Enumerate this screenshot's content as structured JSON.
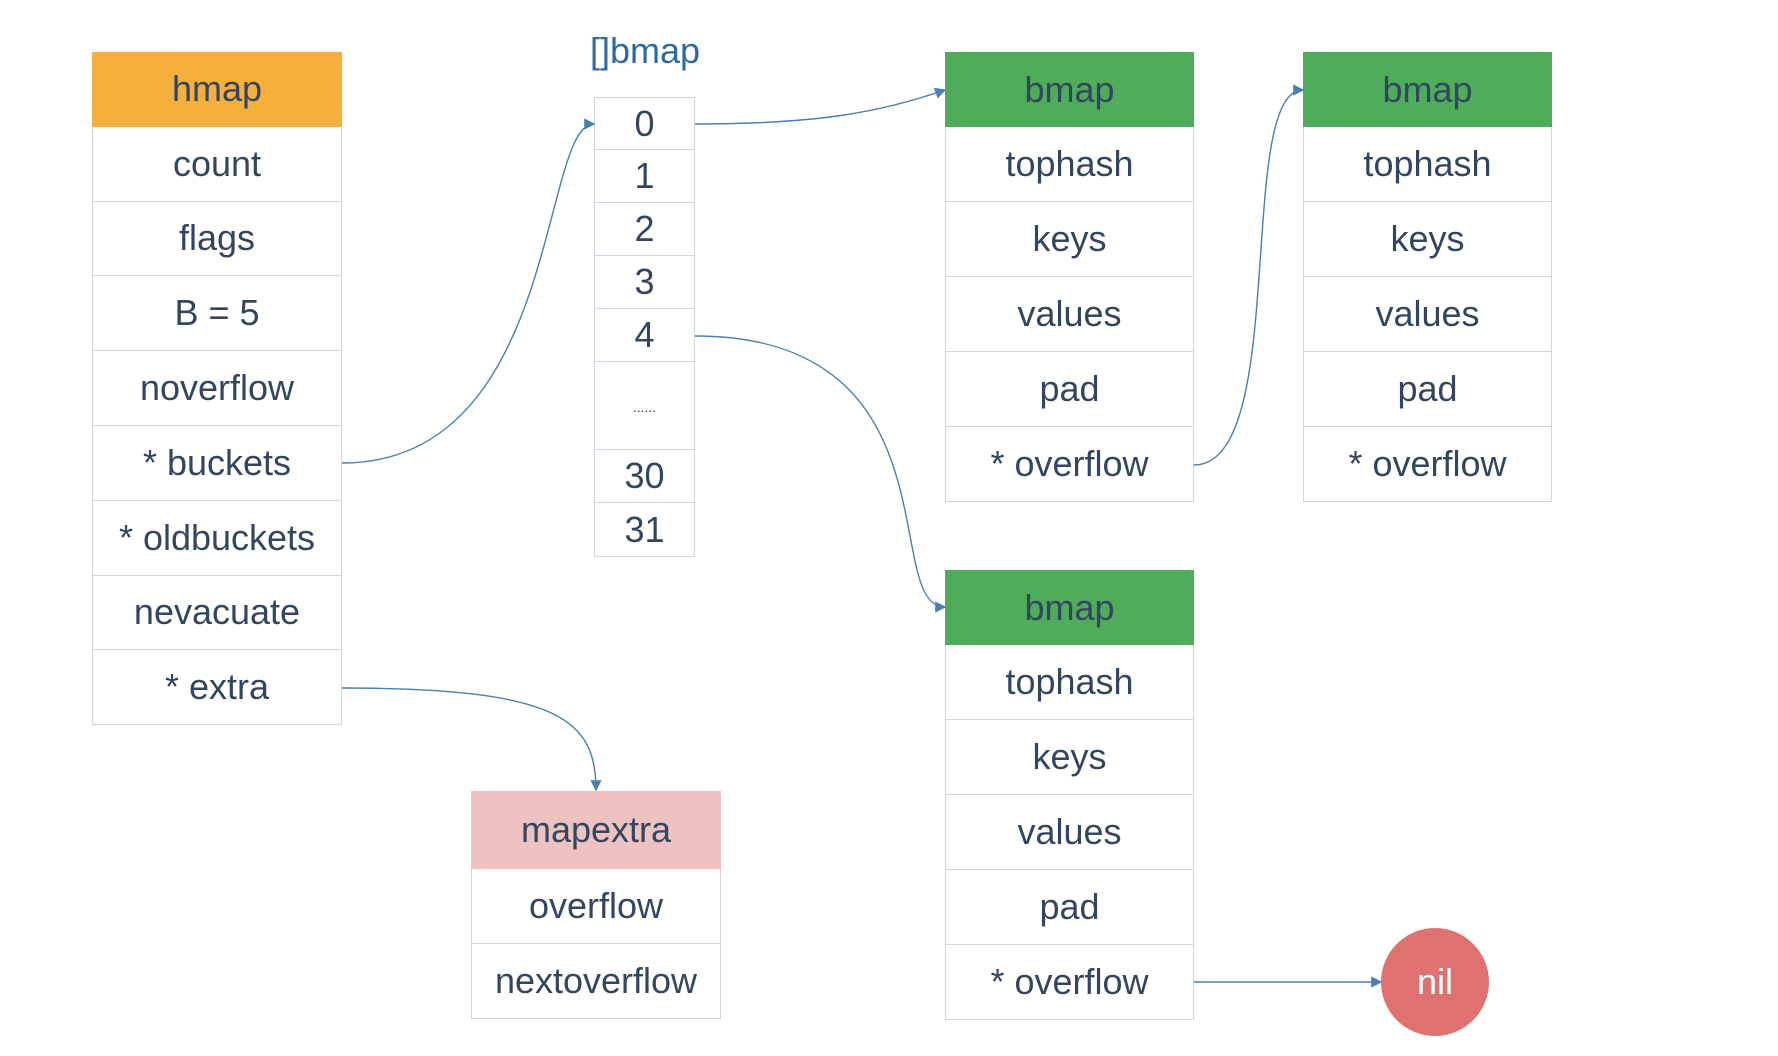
{
  "colors": {
    "hmap": "#F4AF3D",
    "bmap": "#4FAC5B",
    "mapextra": "#EEC2C1",
    "nil": "#DF7271",
    "arrow": "#4A7FB0"
  },
  "hmap": {
    "title": "hmap",
    "fields": [
      "count",
      "flags",
      "B = 5",
      "noverflow",
      "* buckets",
      "* oldbuckets",
      "nevacuate",
      "* extra"
    ]
  },
  "bucket_array": {
    "title": "[]bmap",
    "cells": [
      "0",
      "1",
      "2",
      "3",
      "4",
      "......",
      "30",
      "31"
    ]
  },
  "bmaps": [
    {
      "title": "bmap",
      "fields": [
        "tophash",
        "keys",
        "values",
        "pad",
        "* overflow"
      ]
    },
    {
      "title": "bmap",
      "fields": [
        "tophash",
        "keys",
        "values",
        "pad",
        "* overflow"
      ]
    },
    {
      "title": "bmap",
      "fields": [
        "tophash",
        "keys",
        "values",
        "pad",
        "* overflow"
      ]
    }
  ],
  "mapextra": {
    "title": "mapextra",
    "fields": [
      "overflow",
      "nextoverflow"
    ]
  },
  "nil": {
    "label": "nil"
  },
  "edges": [
    {
      "from": "hmap.* buckets",
      "to": "[]bmap[0]"
    },
    {
      "from": "hmap.* extra",
      "to": "mapextra"
    },
    {
      "from": "[]bmap[0]",
      "to": "bmap (top)"
    },
    {
      "from": "[]bmap[4]",
      "to": "bmap (bottom)"
    },
    {
      "from": "bmap (top).* overflow",
      "to": "bmap (right)"
    },
    {
      "from": "bmap (bottom).* overflow",
      "to": "nil"
    }
  ]
}
